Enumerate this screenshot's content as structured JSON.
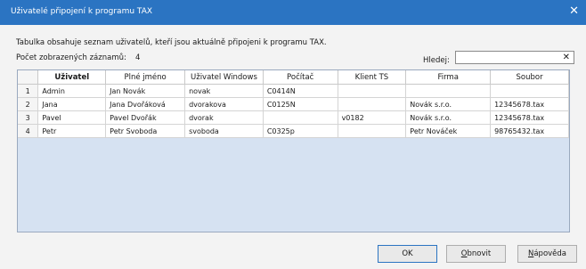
{
  "window": {
    "title": "Uživatelé připojení k programu TAX",
    "close_glyph": "✕"
  },
  "description": "Tabulka obsahuje seznam uživatelů, kteří jsou aktuálně připojeni k programu TAX.",
  "count": {
    "label": "Počet zobrazených záznamů:",
    "value": "4"
  },
  "search": {
    "label": "Hledej:",
    "value": "",
    "clear_glyph": "✕"
  },
  "table": {
    "columns": [
      "Uživatel",
      "Plné jméno",
      "Uživatel Windows",
      "Počítač",
      "Klient TS",
      "Firma",
      "Soubor"
    ],
    "rows": [
      {
        "num": "1",
        "cells": [
          "Admin",
          "Jan Novák",
          "novak",
          "C0414N",
          "",
          "",
          ""
        ]
      },
      {
        "num": "2",
        "cells": [
          "Jana",
          "Jana Dvořáková",
          "dvorakova",
          "C0125N",
          "",
          "Novák s.r.o.",
          "12345678.tax"
        ]
      },
      {
        "num": "3",
        "cells": [
          "Pavel",
          "Pavel Dvořák",
          "dvorak",
          "",
          "v0182",
          "Novák s.r.o.",
          "12345678.tax"
        ]
      },
      {
        "num": "4",
        "cells": [
          "Petr",
          "Petr Svoboda",
          "svoboda",
          "C0325p",
          "",
          "Petr Nováček",
          "98765432.tax"
        ]
      }
    ]
  },
  "buttons": {
    "ok": "OK",
    "refresh_first": "O",
    "refresh_rest": "bnovit",
    "help_first": "N",
    "help_rest": "ápověda"
  },
  "colors": {
    "titlebar": "#2b74c2",
    "table_bg": "#d6e2f2"
  }
}
